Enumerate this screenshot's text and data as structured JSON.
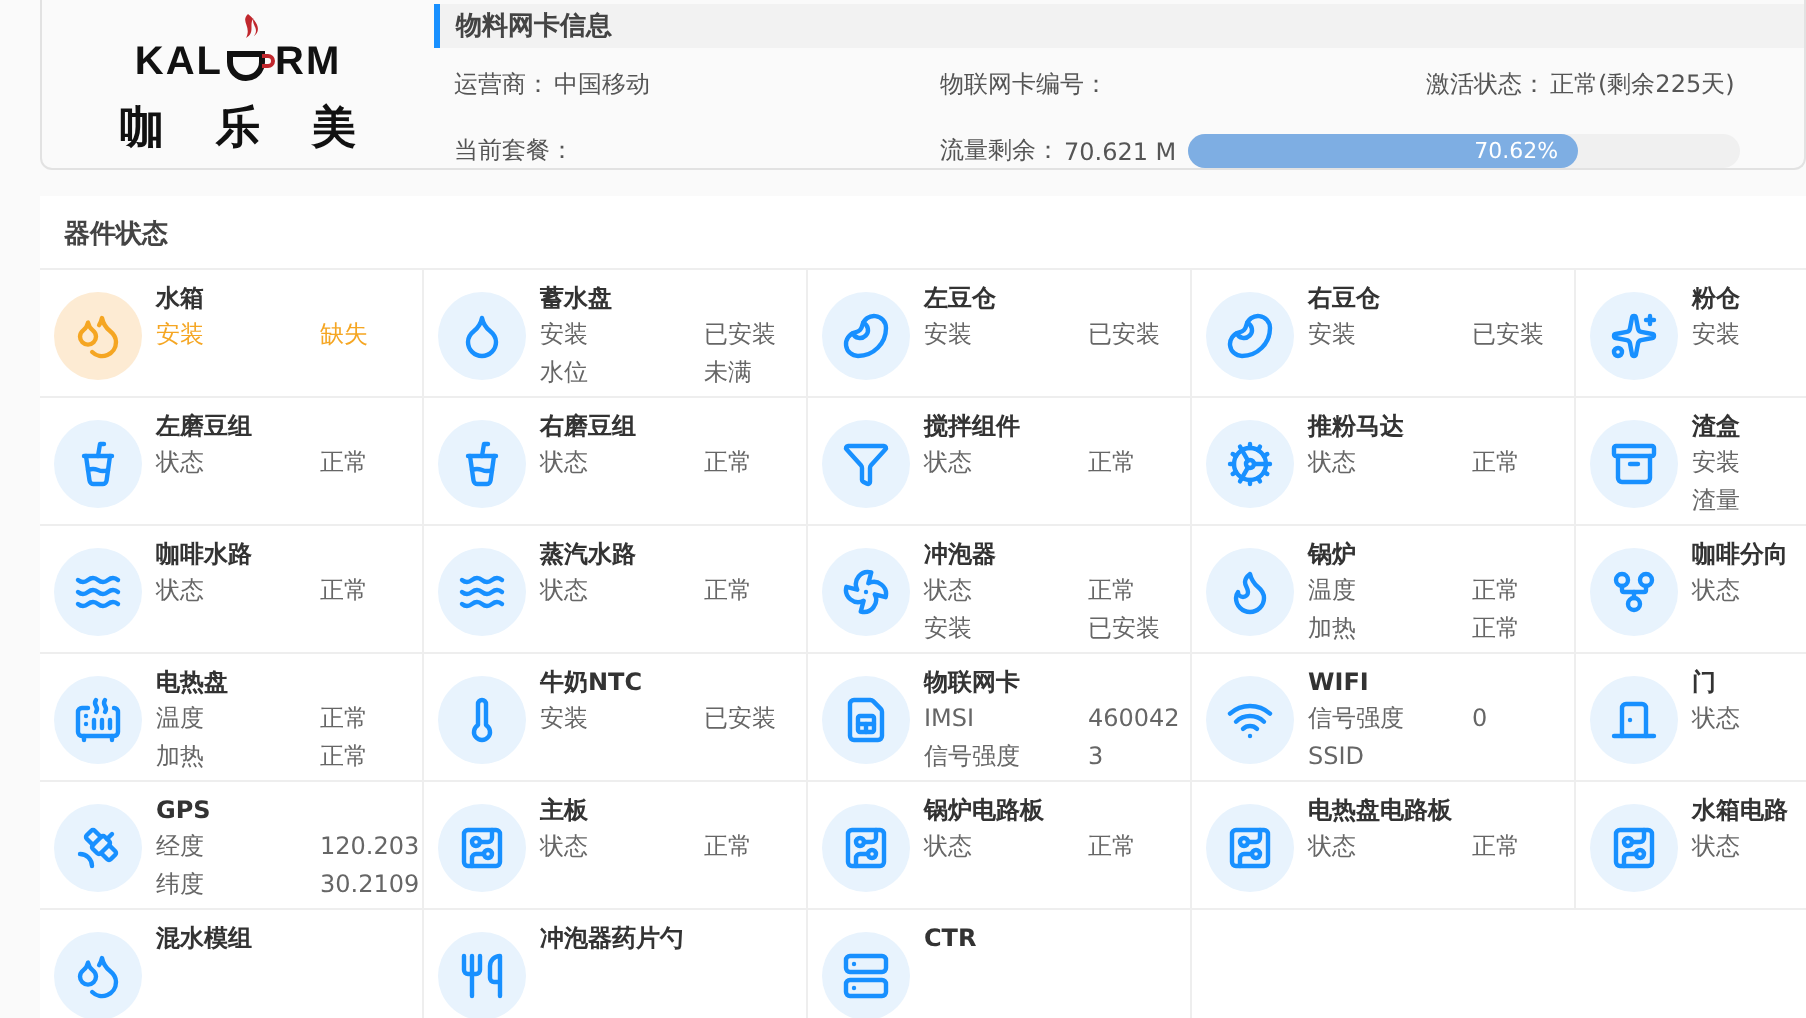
{
  "logo": {
    "left": "KAL",
    "right": "RM",
    "chinese": [
      "咖",
      "乐",
      "美"
    ]
  },
  "sim_info": {
    "title": "物料网卡信息",
    "fields": [
      {
        "label": "运营商：",
        "value": "中国移动"
      },
      {
        "label": "物联网卡编号："
      },
      {
        "label": "激活状态：",
        "value": "正常(剩余225天)"
      },
      {
        "label": "当前套餐："
      },
      {
        "label": "流量剩余：",
        "value": "70.621 M",
        "level": 0.7062,
        "reading": "70.62%"
      }
    ]
  },
  "devices": {
    "title": "器件状态",
    "items": [
      {
        "name": "水箱",
        "alert": true,
        "lines": [
          {
            "label": "安装",
            "value": "缺失"
          }
        ]
      },
      {
        "name": "蓄水盘",
        "alert": false,
        "lines": [
          {
            "label": "安装",
            "value": "已安装"
          },
          {
            "label": "水位",
            "value": "未满"
          }
        ]
      },
      {
        "name": "左豆仓",
        "alert": false,
        "lines": [
          {
            "label": "安装",
            "value": "已安装"
          }
        ]
      },
      {
        "name": "右豆仓",
        "alert": false,
        "lines": [
          {
            "label": "安装",
            "value": "已安装"
          }
        ]
      },
      {
        "name": "粉仓",
        "alert": false,
        "lines": [
          {
            "label": "安装"
          }
        ]
      },
      {
        "name": "左磨豆组",
        "alert": false,
        "lines": [
          {
            "label": "状态",
            "value": "正常"
          }
        ]
      },
      {
        "name": "右磨豆组",
        "alert": false,
        "lines": [
          {
            "label": "状态",
            "value": "正常"
          }
        ]
      },
      {
        "name": "搅拌组件",
        "alert": false,
        "lines": [
          {
            "label": "状态",
            "value": "正常"
          }
        ]
      },
      {
        "name": "推粉马达",
        "alert": false,
        "lines": [
          {
            "label": "状态",
            "value": "正常"
          }
        ]
      },
      {
        "name": "渣盒",
        "alert": false,
        "lines": [
          {
            "label": "安装"
          },
          {
            "label": "渣量"
          }
        ]
      },
      {
        "name": "咖啡水路",
        "alert": false,
        "lines": [
          {
            "label": "状态",
            "value": "正常"
          }
        ]
      },
      {
        "name": "蒸汽水路",
        "alert": false,
        "lines": [
          {
            "label": "状态",
            "value": "正常"
          }
        ]
      },
      {
        "name": "冲泡器",
        "alert": false,
        "lines": [
          {
            "label": "状态",
            "value": "正常"
          },
          {
            "label": "安装",
            "value": "已安装"
          }
        ]
      },
      {
        "name": "锅炉",
        "alert": false,
        "lines": [
          {
            "label": "温度",
            "value": "正常"
          },
          {
            "label": "加热",
            "value": "正常"
          }
        ]
      },
      {
        "name": "咖啡分向",
        "alert": false,
        "lines": [
          {
            "label": "状态"
          }
        ]
      },
      {
        "name": "电热盘",
        "alert": false,
        "lines": [
          {
            "label": "温度",
            "value": "正常"
          },
          {
            "label": "加热",
            "value": "正常"
          }
        ]
      },
      {
        "name": "牛奶NTC",
        "alert": false,
        "lines": [
          {
            "label": "安装",
            "value": "已安装"
          }
        ]
      },
      {
        "name": "物联网卡",
        "alert": false,
        "lines": [
          {
            "label": "IMSI",
            "value": "460042"
          },
          {
            "label": "信号强度",
            "value": "3"
          }
        ]
      },
      {
        "name": "WIFI",
        "alert": false,
        "lines": [
          {
            "label": "信号强度",
            "value": "0"
          },
          {
            "label": "SSID"
          }
        ]
      },
      {
        "name": "门",
        "alert": false,
        "lines": [
          {
            "label": "状态"
          }
        ]
      },
      {
        "name": "GPS",
        "alert": false,
        "lines": [
          {
            "label": "经度",
            "value": "120.203"
          },
          {
            "label": "纬度",
            "value": "30.2109"
          }
        ]
      },
      {
        "name": "主板",
        "alert": false,
        "lines": [
          {
            "label": "状态",
            "value": "正常"
          }
        ]
      },
      {
        "name": "锅炉电路板",
        "alert": false,
        "lines": [
          {
            "label": "状态",
            "value": "正常"
          }
        ]
      },
      {
        "name": "电热盘电路板",
        "alert": false,
        "lines": [
          {
            "label": "状态",
            "value": "正常"
          }
        ]
      },
      {
        "name": "水箱电路",
        "alert": false,
        "lines": [
          {
            "label": "状态"
          }
        ]
      },
      {
        "name": "混水模组",
        "alert": false
      },
      {
        "name": "冲泡器药片勺",
        "alert": false
      },
      {
        "name": "CTR",
        "alert": false
      }
    ]
  }
}
